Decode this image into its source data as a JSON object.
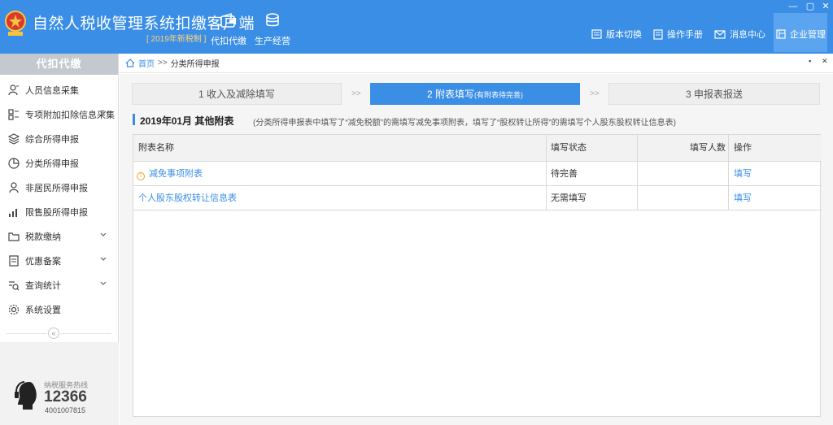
{
  "app": {
    "title": "自然人税收管理系统扣缴客户端",
    "subtitle": "[ 2019年新税制 ]"
  },
  "header": {
    "nav": [
      {
        "label": "代扣代缴",
        "icon": "wallet-icon"
      },
      {
        "label": "生产经营",
        "icon": "coins-icon"
      }
    ],
    "buttons": [
      {
        "label": "版本切换",
        "icon": "version-icon"
      },
      {
        "label": "操作手册",
        "icon": "manual-icon"
      },
      {
        "label": "消息中心",
        "icon": "mail-icon"
      },
      {
        "label": "企业管理",
        "icon": "building-icon"
      }
    ],
    "window_controls": {
      "minimize": "—",
      "restore": "▢",
      "close": "✕"
    }
  },
  "sidebar": {
    "title": "代扣代缴",
    "items": [
      {
        "label": "人员信息采集",
        "icon": "person-add-icon",
        "expandable": false
      },
      {
        "label": "专项附加扣除信息采集",
        "icon": "grid-icon",
        "expandable": true
      },
      {
        "label": "综合所得申报",
        "icon": "layers-icon",
        "expandable": false
      },
      {
        "label": "分类所得申报",
        "icon": "pie-icon",
        "expandable": false
      },
      {
        "label": "非居民所得申报",
        "icon": "person-icon",
        "expandable": false
      },
      {
        "label": "限售股所得申报",
        "icon": "bar-chart-icon",
        "expandable": false
      },
      {
        "label": "税款缴纳",
        "icon": "folder-icon",
        "expandable": true
      },
      {
        "label": "优惠备案",
        "icon": "document-icon",
        "expandable": true
      },
      {
        "label": "查询统计",
        "icon": "search-list-icon",
        "expandable": true
      },
      {
        "label": "系统设置",
        "icon": "gear-icon",
        "expandable": false
      }
    ],
    "collapse_symbol": "«",
    "hotline": {
      "label": "纳税服务热线",
      "number": "12366",
      "phone": "4001007815"
    }
  },
  "breadcrumb": {
    "home": "首页",
    "separator": ">>",
    "current": "分类所得申报"
  },
  "steps": [
    {
      "label": "1 收入及减除填写",
      "note": "",
      "active": false
    },
    {
      "label": "2 附表填写",
      "note": "(有附表待完善)",
      "active": true
    },
    {
      "label": "3 申报表报送",
      "note": "",
      "active": false
    }
  ],
  "step_arrow": ">>",
  "section": {
    "title": "2019年01月  其他附表",
    "note": "(分类所得申报表中填写了“减免税额”的需填写减免事项附表，填写了“股权转让所得”的需填写个人股东股权转让信息表)"
  },
  "table": {
    "columns": [
      "附表名称",
      "填写状态",
      "填写人数",
      "操作"
    ],
    "rows": [
      {
        "name": "减免事项附表",
        "status": "待完善",
        "count": "",
        "action": "填写",
        "warning": true
      },
      {
        "name": "个人股东股权转让信息表",
        "status": "无需填写",
        "count": "",
        "action": "填写",
        "warning": false
      }
    ]
  },
  "colors": {
    "primary": "#3a8ee6",
    "warning": "#f0a020"
  }
}
